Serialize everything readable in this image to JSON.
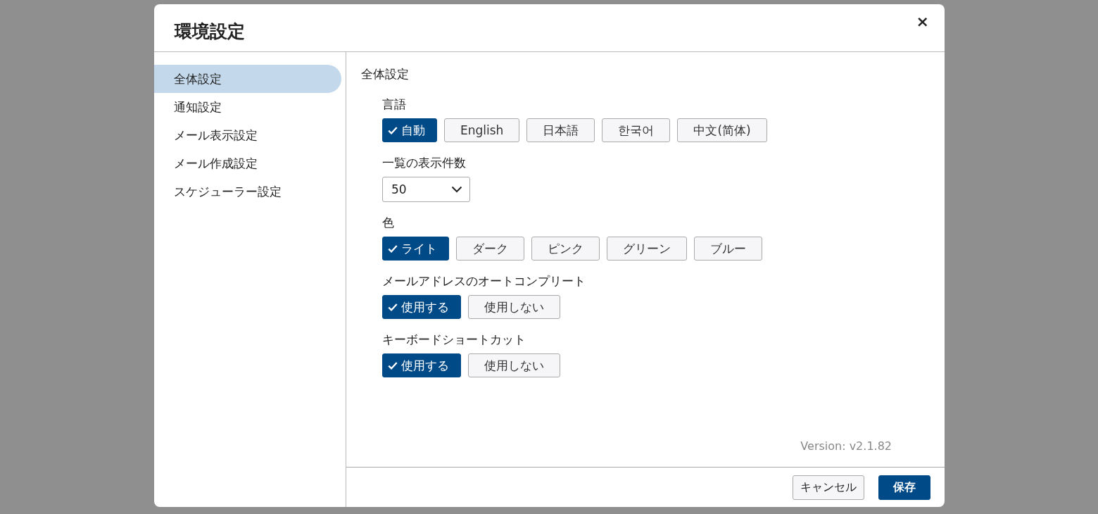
{
  "dialog": {
    "title": "環境設定",
    "close": "×"
  },
  "sidebar": {
    "items": [
      {
        "label": "全体設定",
        "selected": true
      },
      {
        "label": "通知設定",
        "selected": false
      },
      {
        "label": "メール表示設定",
        "selected": false
      },
      {
        "label": "メール作成設定",
        "selected": false
      },
      {
        "label": "スケジューラー設定",
        "selected": false
      }
    ]
  },
  "content": {
    "heading": "全体設定",
    "settings": [
      {
        "kind": "choice",
        "label": "言語",
        "options": [
          {
            "label": "自動",
            "selected": true
          },
          {
            "label": "English",
            "selected": false
          },
          {
            "label": "日本語",
            "selected": false
          },
          {
            "label": "한국어",
            "selected": false
          },
          {
            "label": "中文(简体)",
            "selected": false
          }
        ]
      },
      {
        "kind": "select",
        "label": "一覧の表示件数",
        "value": "50"
      },
      {
        "kind": "choice",
        "label": "色",
        "options": [
          {
            "label": "ライト",
            "selected": true
          },
          {
            "label": "ダーク",
            "selected": false
          },
          {
            "label": "ピンク",
            "selected": false
          },
          {
            "label": "グリーン",
            "selected": false
          },
          {
            "label": "ブルー",
            "selected": false
          }
        ]
      },
      {
        "kind": "choice",
        "label": "メールアドレスのオートコンプリート",
        "options": [
          {
            "label": "使用する",
            "selected": true
          },
          {
            "label": "使用しない",
            "selected": false
          }
        ]
      },
      {
        "kind": "choice",
        "label": "キーボードショートカット",
        "options": [
          {
            "label": "使用する",
            "selected": true
          },
          {
            "label": "使用しない",
            "selected": false
          }
        ]
      }
    ],
    "version": "Version: v2.1.82"
  },
  "footer": {
    "buttons": [
      {
        "label": "キャンセル",
        "kind": "secondary"
      },
      {
        "label": "保存",
        "kind": "primary"
      }
    ]
  }
}
